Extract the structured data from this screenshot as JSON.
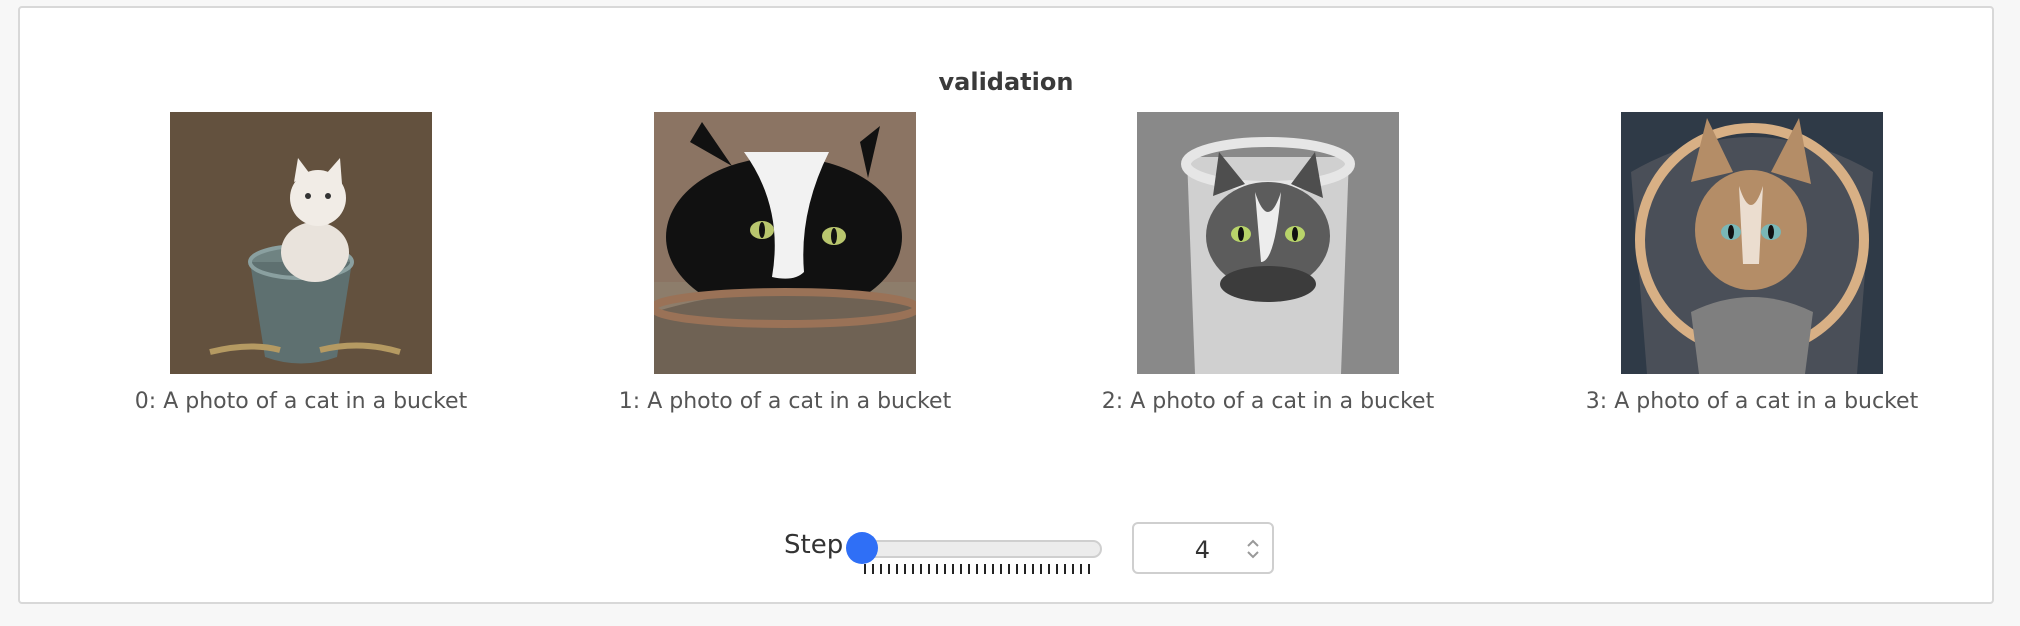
{
  "panel": {
    "title": "validation"
  },
  "images": [
    {
      "caption": "0: A photo of a cat in a bucket"
    },
    {
      "caption": "1: A photo of a cat in a bucket"
    },
    {
      "caption": "2: A photo of a cat in a bucket"
    },
    {
      "caption": "3: A photo of a cat in a bucket"
    }
  ],
  "step_control": {
    "label": "Step",
    "value": "4",
    "slider_fraction": 0.0,
    "accent_color": "#2f6ff6"
  }
}
